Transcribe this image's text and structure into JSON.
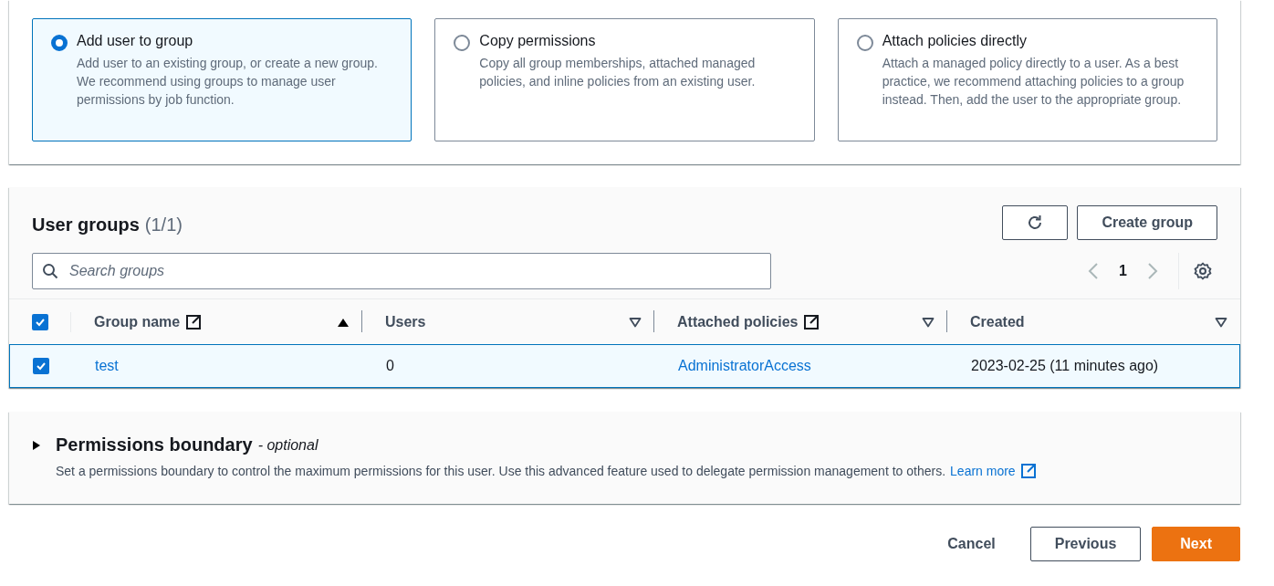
{
  "access_options": [
    {
      "title": "Add user to group",
      "description": "Add user to an existing group, or create a new group. We recommend using groups to manage user permissions by job function.",
      "selected": true
    },
    {
      "title": "Copy permissions",
      "description": "Copy all group memberships, attached managed policies, and inline policies from an existing user.",
      "selected": false
    },
    {
      "title": "Attach policies directly",
      "description": "Attach a managed policy directly to a user. As a best practice, we recommend attaching policies to a group instead. Then, add the user to the appropriate group.",
      "selected": false
    }
  ],
  "user_groups": {
    "title": "User groups",
    "count": "(1/1)",
    "create_button": "Create group",
    "search": {
      "placeholder": "Search groups"
    },
    "pagination": {
      "page": "1"
    },
    "table": {
      "select_all_checked": true,
      "columns": [
        {
          "label": "Group name",
          "external_link": true,
          "sorted": true
        },
        {
          "label": "Users",
          "external_link": false,
          "sorted": false
        },
        {
          "label": "Attached policies",
          "external_link": true,
          "sorted": false
        },
        {
          "label": "Created",
          "external_link": false,
          "sorted": false
        }
      ],
      "rows": [
        {
          "selected": true,
          "cells": [
            {
              "text": "test",
              "kind": "link"
            },
            {
              "text": "0",
              "kind": "text"
            },
            {
              "text": "AdministratorAccess",
              "kind": "link"
            },
            {
              "text": "2023-02-25 (11 minutes ago)",
              "kind": "text"
            }
          ]
        }
      ]
    }
  },
  "permissions_boundary": {
    "title": "Permissions boundary",
    "optional": "- optional",
    "expanded": false,
    "description": "Set a permissions boundary to control the maximum permissions for this user. Use this advanced feature used to delegate permission management to others.",
    "link": "Learn more"
  },
  "actions": [
    {
      "label": "Cancel",
      "kind": "link"
    },
    {
      "label": "Previous",
      "kind": "secondary"
    },
    {
      "label": "Next",
      "kind": "primary"
    }
  ]
}
